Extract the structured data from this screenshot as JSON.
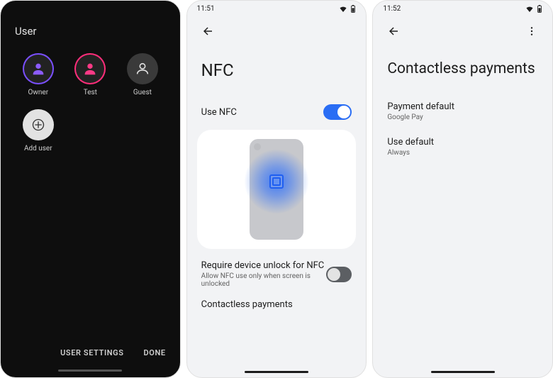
{
  "screen1": {
    "header": "User",
    "users": [
      {
        "label": "Owner"
      },
      {
        "label": "Test"
      },
      {
        "label": "Guest"
      },
      {
        "label": "Add user"
      }
    ],
    "footer_settings": "USER SETTINGS",
    "footer_done": "DONE"
  },
  "screen2": {
    "time": "11:51",
    "title": "NFC",
    "use_nfc": "Use NFC",
    "require_unlock_title": "Require device unlock for NFC",
    "require_unlock_sub": "Allow NFC use only when screen is unlocked",
    "contactless": "Contactless payments"
  },
  "screen3": {
    "time": "11:52",
    "title": "Contactless payments",
    "payment_default_label": "Payment default",
    "payment_default_value": "Google Pay",
    "use_default_label": "Use default",
    "use_default_value": "Always"
  }
}
